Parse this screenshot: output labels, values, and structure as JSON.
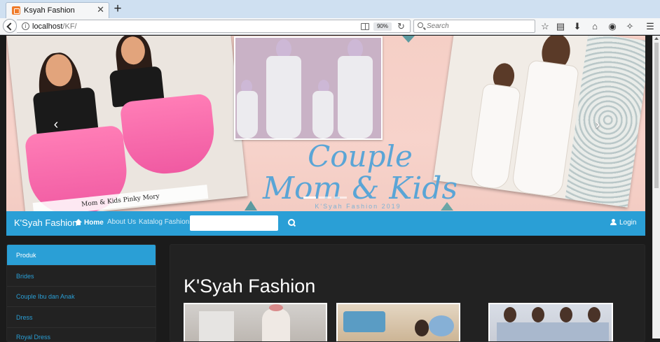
{
  "browser": {
    "tab_title": "Ksyah Fashion",
    "url_host": "localhost",
    "url_path": "/KF/",
    "zoom": "90%",
    "search_placeholder": "Search"
  },
  "carousel": {
    "title_line1": "Couple",
    "title_line2": "Mom & Kids",
    "footer": "K'Syah Fashion 2019",
    "left_caption": "Mom & Kids Pinky Mory",
    "prev_glyph": "‹",
    "next_glyph": "›"
  },
  "navbar": {
    "brand": "K'Syah Fashion",
    "home": "Home",
    "about": "About Us",
    "katalog": "Katalog Fashion",
    "login": "Login",
    "search_value": ""
  },
  "sidebar": {
    "items": [
      {
        "label": "Produk"
      },
      {
        "label": "Brides"
      },
      {
        "label": "Couple Ibu dan Anak"
      },
      {
        "label": "Dress"
      },
      {
        "label": "Royal Dress"
      }
    ]
  },
  "main": {
    "title": "K'Syah Fashion"
  },
  "colors": {
    "accent": "#2a9fd6",
    "background": "#1b1b1b",
    "panel": "#222222"
  }
}
